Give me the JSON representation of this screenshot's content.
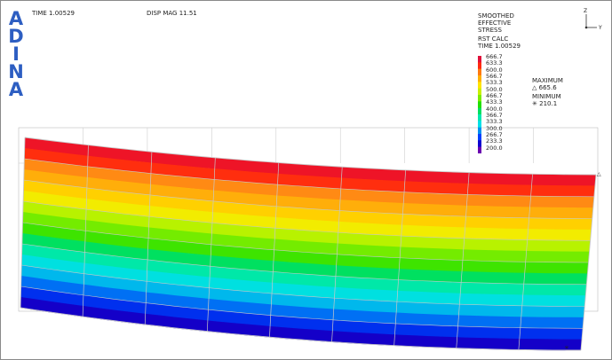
{
  "header": {
    "time_label": "TIME 1.00529",
    "disp_mag_label": "DISP MAG 11.51"
  },
  "logo": {
    "letters": [
      "A",
      "D",
      "I",
      "N",
      "A"
    ]
  },
  "axis_triad": {
    "z_label": "Z",
    "y_label": "Y"
  },
  "band_plot": {
    "title_lines": [
      "SMOOTHED",
      "EFFECTIVE",
      "STRESS",
      "RST CALC",
      "TIME 1.00529"
    ],
    "levels": [
      "666.7",
      "633.3",
      "600.0",
      "566.7",
      "533.3",
      "500.0",
      "466.7",
      "433.3",
      "400.0",
      "366.7",
      "333.3",
      "300.0",
      "266.7",
      "233.3",
      "200.0"
    ],
    "colors": [
      "#e0103a",
      "#ff2a10",
      "#ff7a10",
      "#ffb000",
      "#ffe400",
      "#c8f000",
      "#7ced00",
      "#22e000",
      "#00e060",
      "#00e8b0",
      "#00e0e8",
      "#0090f0",
      "#0040ff",
      "#1000d0",
      "#6a00b0"
    ],
    "maximum_label": "MAXIMUM",
    "maximum_value": "665.6",
    "minimum_label": "MINIMUM",
    "minimum_value": "210.1"
  },
  "model": {
    "band_colors_top_to_bottom": [
      "#ee1427",
      "#ff2e0e",
      "#ff8a14",
      "#ffae0a",
      "#ffd000",
      "#f2ec00",
      "#b8f200",
      "#74ec00",
      "#3ee400",
      "#00e060",
      "#00e8a8",
      "#00e0e0",
      "#00b8ec",
      "#0070f4",
      "#0030ee",
      "#1400c8"
    ],
    "mesh_line_color": "#c8c8c8"
  }
}
